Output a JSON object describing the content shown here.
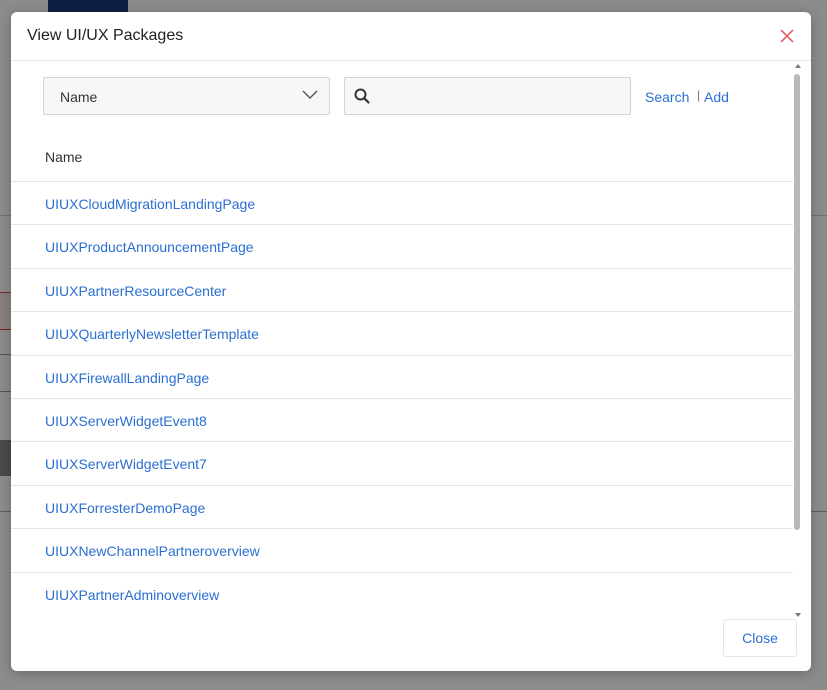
{
  "modal": {
    "title": "View UI/UX Packages",
    "close_icon": "close-x-icon"
  },
  "filter": {
    "field_select_value": "Name",
    "search_placeholder": "",
    "search_value": "",
    "search_link": "Search",
    "separator": "|",
    "add_link": "Add"
  },
  "table": {
    "column_header": "Name",
    "rows": [
      "UIUXCloudMigrationLandingPage",
      "UIUXProductAnnouncementPage",
      "UIUXPartnerResourceCenter",
      "UIUXQuarterlyNewsletterTemplate",
      "UIUXFirewallLandingPage",
      "UIUXServerWidgetEvent8",
      "UIUXServerWidgetEvent7",
      "UIUXForresterDemoPage",
      "UIUXNewChannelPartneroverview",
      "UIUXPartnerAdminoverview"
    ]
  },
  "footer": {
    "close_label": "Close"
  },
  "colors": {
    "link": "#2b6fd1",
    "overlay": "rgba(0,0,0,0.45)"
  }
}
